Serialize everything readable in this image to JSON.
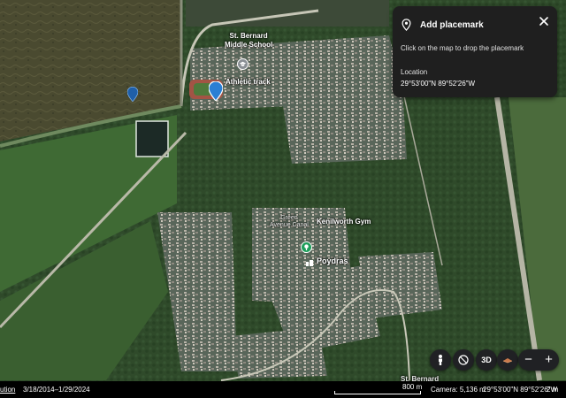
{
  "map": {
    "labels": {
      "school_line1": "St. Bernard",
      "school_line2": "Middle School",
      "athletic_track": "Athletic track",
      "kenilworth_gym": "Kenilworth Gym",
      "poydras": "Poydras",
      "canal_line1": "Green",
      "canal_line2": "Avenue Canal",
      "st_bernard_bottom": "St. Bernard"
    },
    "icons": {
      "school_poi": "school-icon",
      "gym_poi": "gym-icon",
      "poydras_poi": "town-icon",
      "active_marker": "placemark-pin-icon",
      "dropped_marker": "placemark-pin-icon"
    },
    "colors": {
      "marker_active": "#2a7fd4",
      "marker_dropped": "#1f5fa8",
      "poi_green": "#1e9e5a",
      "poi_grey": "#8a8f94"
    }
  },
  "panel": {
    "title": "Add placemark",
    "instruction": "Click on the map to drop the placemark",
    "location_label": "Location",
    "coordinates": "29°53'00\"N 89°52'26\"W",
    "pin_icon": "placemark-icon",
    "close_icon": "close-icon"
  },
  "controls": {
    "pegman": "pegman-icon",
    "compass": "compass-icon",
    "three_d": "3D",
    "layers": "layers-icon",
    "zoom_out": "−",
    "zoom_in": "+"
  },
  "statusbar": {
    "attribution": "ution",
    "imagery_dates": "3/18/2014–1/29/2024",
    "scale": "800 m",
    "camera": "Camera: 5,136 m",
    "coords": "29°53'00\"N 89°52'26\"W",
    "elevation": "2 m"
  }
}
